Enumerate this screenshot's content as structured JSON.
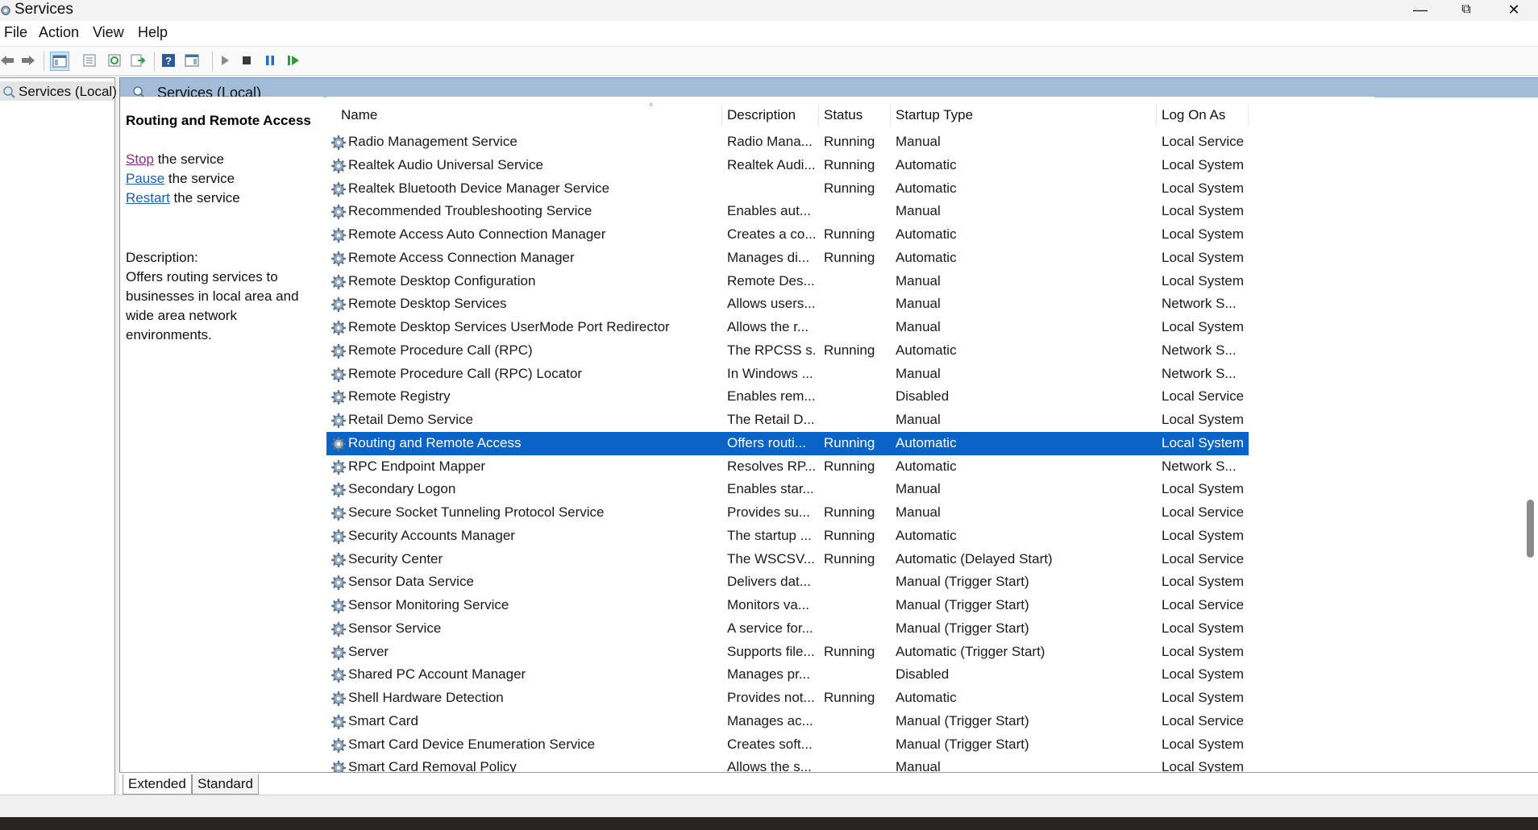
{
  "window": {
    "title": "Services",
    "minimize": "—",
    "maximize": "⧉",
    "close": "✕"
  },
  "menu": [
    "File",
    "Action",
    "View",
    "Help"
  ],
  "toolbar_icons": [
    "back-icon",
    "forward-icon",
    "show-hide-console-tree-icon",
    "properties-icon",
    "refresh-icon",
    "export-list-icon",
    "help-icon",
    "show-action-pane-icon",
    "start-service-icon",
    "stop-service-icon",
    "pause-service-icon",
    "resume-service-icon"
  ],
  "tree": {
    "label": "Services (Local)"
  },
  "main_header": "Services (Local)",
  "extended": {
    "service_name": "Routing and Remote Access",
    "actions": [
      {
        "link": "Stop",
        "rest": " the service"
      },
      {
        "link": "Pause",
        "rest": " the service"
      },
      {
        "link": "Restart",
        "rest": " the service"
      }
    ],
    "description_label": "Description:",
    "description": "Offers routing services to businesses in local area and wide area network environments."
  },
  "columns": [
    "Name",
    "Description",
    "Status",
    "Startup Type",
    "Log On As"
  ],
  "services": [
    {
      "name": "Radio Management Service",
      "desc": "Radio Mana...",
      "status": "Running",
      "startup": "Manual",
      "logon": "Local Service"
    },
    {
      "name": "Realtek Audio Universal Service",
      "desc": "Realtek Audi...",
      "status": "Running",
      "startup": "Automatic",
      "logon": "Local System"
    },
    {
      "name": "Realtek Bluetooth Device Manager Service",
      "desc": "",
      "status": "Running",
      "startup": "Automatic",
      "logon": "Local System"
    },
    {
      "name": "Recommended Troubleshooting Service",
      "desc": "Enables aut...",
      "status": "",
      "startup": "Manual",
      "logon": "Local System"
    },
    {
      "name": "Remote Access Auto Connection Manager",
      "desc": "Creates a co...",
      "status": "Running",
      "startup": "Automatic",
      "logon": "Local System"
    },
    {
      "name": "Remote Access Connection Manager",
      "desc": "Manages di...",
      "status": "Running",
      "startup": "Automatic",
      "logon": "Local System"
    },
    {
      "name": "Remote Desktop Configuration",
      "desc": "Remote Des...",
      "status": "",
      "startup": "Manual",
      "logon": "Local System"
    },
    {
      "name": "Remote Desktop Services",
      "desc": "Allows users...",
      "status": "",
      "startup": "Manual",
      "logon": "Network S..."
    },
    {
      "name": "Remote Desktop Services UserMode Port Redirector",
      "desc": "Allows the r...",
      "status": "",
      "startup": "Manual",
      "logon": "Local System"
    },
    {
      "name": "Remote Procedure Call (RPC)",
      "desc": "The RPCSS s...",
      "status": "Running",
      "startup": "Automatic",
      "logon": "Network S..."
    },
    {
      "name": "Remote Procedure Call (RPC) Locator",
      "desc": "In Windows ...",
      "status": "",
      "startup": "Manual",
      "logon": "Network S..."
    },
    {
      "name": "Remote Registry",
      "desc": "Enables rem...",
      "status": "",
      "startup": "Disabled",
      "logon": "Local Service"
    },
    {
      "name": "Retail Demo Service",
      "desc": "The Retail D...",
      "status": "",
      "startup": "Manual",
      "logon": "Local System"
    },
    {
      "name": "Routing and Remote Access",
      "desc": "Offers routi...",
      "status": "Running",
      "startup": "Automatic",
      "logon": "Local System",
      "selected": true
    },
    {
      "name": "RPC Endpoint Mapper",
      "desc": "Resolves RP...",
      "status": "Running",
      "startup": "Automatic",
      "logon": "Network S..."
    },
    {
      "name": "Secondary Logon",
      "desc": "Enables star...",
      "status": "",
      "startup": "Manual",
      "logon": "Local System"
    },
    {
      "name": "Secure Socket Tunneling Protocol Service",
      "desc": "Provides su...",
      "status": "Running",
      "startup": "Manual",
      "logon": "Local Service"
    },
    {
      "name": "Security Accounts Manager",
      "desc": "The startup ...",
      "status": "Running",
      "startup": "Automatic",
      "logon": "Local System"
    },
    {
      "name": "Security Center",
      "desc": "The WSCSV...",
      "status": "Running",
      "startup": "Automatic (Delayed Start)",
      "logon": "Local Service"
    },
    {
      "name": "Sensor Data Service",
      "desc": "Delivers dat...",
      "status": "",
      "startup": "Manual (Trigger Start)",
      "logon": "Local System"
    },
    {
      "name": "Sensor Monitoring Service",
      "desc": "Monitors va...",
      "status": "",
      "startup": "Manual (Trigger Start)",
      "logon": "Local Service"
    },
    {
      "name": "Sensor Service",
      "desc": "A service for...",
      "status": "",
      "startup": "Manual (Trigger Start)",
      "logon": "Local System"
    },
    {
      "name": "Server",
      "desc": "Supports file...",
      "status": "Running",
      "startup": "Automatic (Trigger Start)",
      "logon": "Local System"
    },
    {
      "name": "Shared PC Account Manager",
      "desc": "Manages pr...",
      "status": "",
      "startup": "Disabled",
      "logon": "Local System"
    },
    {
      "name": "Shell Hardware Detection",
      "desc": "Provides not...",
      "status": "Running",
      "startup": "Automatic",
      "logon": "Local System"
    },
    {
      "name": "Smart Card",
      "desc": "Manages ac...",
      "status": "",
      "startup": "Manual (Trigger Start)",
      "logon": "Local Service"
    },
    {
      "name": "Smart Card Device Enumeration Service",
      "desc": "Creates soft...",
      "status": "",
      "startup": "Manual (Trigger Start)",
      "logon": "Local System"
    },
    {
      "name": "Smart Card Removal Policy",
      "desc": "Allows the s...",
      "status": "",
      "startup": "Manual",
      "logon": "Local System"
    }
  ],
  "tabs": [
    "Extended",
    "Standard"
  ],
  "colors": {
    "selection": "#0a64c8",
    "header": "#a3bcd7",
    "link": "#1a5fb4"
  }
}
